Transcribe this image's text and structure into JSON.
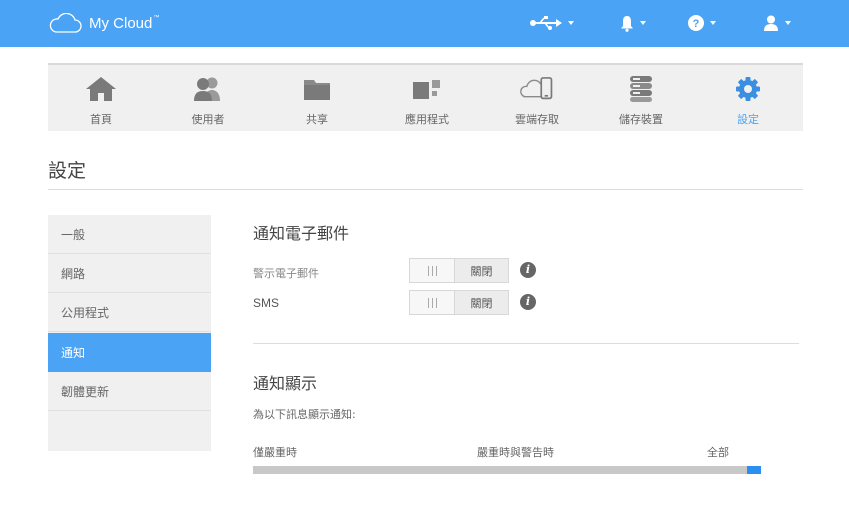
{
  "app": {
    "logo_text": "My Cloud",
    "logo_mark": "™"
  },
  "topbar": {
    "icons": [
      "usb-icon",
      "bell-icon",
      "help-icon",
      "user-icon"
    ]
  },
  "nav": {
    "items": [
      {
        "label": "首頁",
        "icon": "home-icon"
      },
      {
        "label": "使用者",
        "icon": "users-icon"
      },
      {
        "label": "共享",
        "icon": "folder-icon"
      },
      {
        "label": "應用程式",
        "icon": "apps-icon"
      },
      {
        "label": "雲端存取",
        "icon": "cloud-device-icon"
      },
      {
        "label": "儲存裝置",
        "icon": "storage-icon"
      },
      {
        "label": "設定",
        "icon": "gear-icon",
        "active": true
      }
    ]
  },
  "page": {
    "title": "設定"
  },
  "sidebar": {
    "items": [
      {
        "label": "一般"
      },
      {
        "label": "網路"
      },
      {
        "label": "公用程式"
      },
      {
        "label": "通知",
        "active": true
      },
      {
        "label": "韌體更新"
      }
    ]
  },
  "email_section": {
    "title": "通知電子郵件",
    "rows": [
      {
        "label": "警示電子郵件",
        "state": "關閉"
      },
      {
        "label": "SMS",
        "state": "關閉"
      }
    ]
  },
  "display_section": {
    "title": "通知顯示",
    "description": "為以下訊息顯示通知:",
    "levels": [
      "僅嚴重時",
      "嚴重時與警告時",
      "全部"
    ],
    "selected_level": "全部",
    "selected_fraction": 1.0
  },
  "colors": {
    "accent": "#4aa3f5",
    "slider_thumb": "#2b8ef0"
  }
}
